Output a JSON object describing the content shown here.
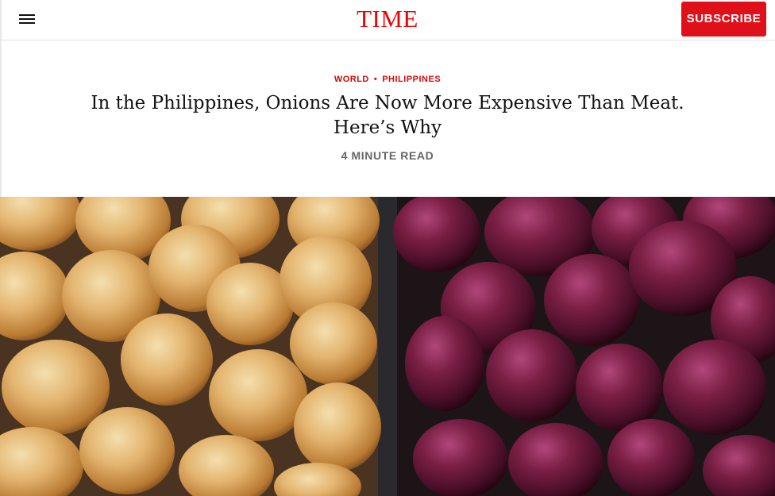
{
  "header": {
    "logo_text": "TIME",
    "subscribe_label": "SUBSCRIBE",
    "menu_icon": "hamburger-menu-icon"
  },
  "article": {
    "kicker": {
      "section": "WORLD",
      "separator": "•",
      "subsection": "PHILIPPINES"
    },
    "headline": "In the Philippines, Onions Are Now More Expensive Than Meat. Here’s Why",
    "read_time": "4 MINUTE READ"
  },
  "colors": {
    "brand_red": "#e90606",
    "subscribe_bg": "#e0101a",
    "kicker_red": "#d10a0a",
    "headline": "#111111",
    "meta_gray": "#666666"
  }
}
